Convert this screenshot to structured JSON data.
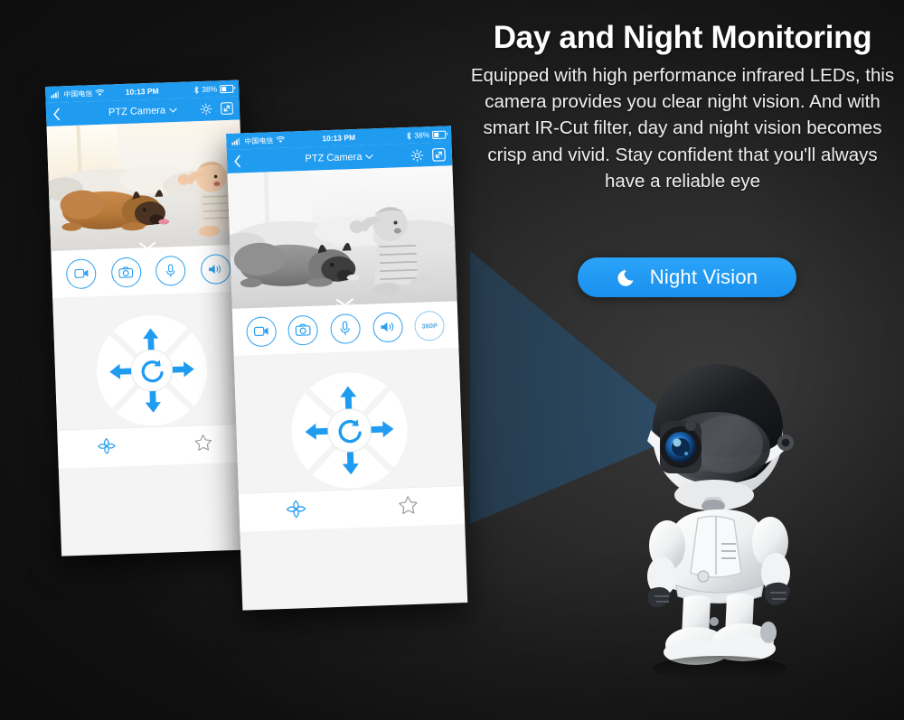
{
  "page": {
    "background_color": "#1d1d1d",
    "accent_color": "#1f9bf0"
  },
  "copy": {
    "title": "Day and Night Monitoring",
    "body": "Equipped with high performance infrared LEDs, this camera provides you clear night vision. And with smart IR-Cut filter, day and night vision becomes crisp and vivid. Stay confident that you'll always have a reliable eye",
    "button": {
      "label": "Night Vision",
      "icon": "moon-stars-icon",
      "color": "#1f9bf0"
    }
  },
  "phones": [
    {
      "id": "phone-day",
      "mode": "day",
      "status_bar": {
        "signal_icon": "signal-bars-icon",
        "carrier": "中国电信",
        "wifi_icon": "wifi-icon",
        "time": "10:13 PM",
        "bluetooth_icon": "bluetooth-icon",
        "battery_percent": "38%",
        "battery_icon": "battery-icon"
      },
      "nav_bar": {
        "back_icon": "chevron-left-icon",
        "title": "PTZ Camera",
        "dropdown_icon": "chevron-down-icon",
        "settings_icon": "gear-icon",
        "fullscreen_icon": "expand-icon"
      },
      "video": {
        "caption": "Dog and baby on floor, color daylight view",
        "grayscale": false
      },
      "expand_icon": "double-chevron-down-icon",
      "toolbar": [
        {
          "name": "record",
          "icon": "video-camera-icon",
          "label": ""
        },
        {
          "name": "snapshot",
          "icon": "photo-camera-icon",
          "label": ""
        },
        {
          "name": "microphone",
          "icon": "microphone-icon",
          "label": ""
        },
        {
          "name": "speaker",
          "icon": "speaker-icon",
          "label": ""
        }
      ],
      "dpad": {
        "up_icon": "arrow-up-icon",
        "down_icon": "arrow-down-icon",
        "left_icon": "arrow-left-icon",
        "right_icon": "arrow-right-icon",
        "center_icon": "rotate-refresh-icon"
      },
      "bottom_bar": [
        {
          "name": "ptz",
          "icon": "ptz-cross-icon"
        },
        {
          "name": "favorite",
          "icon": "star-icon"
        }
      ]
    },
    {
      "id": "phone-night",
      "mode": "night",
      "status_bar": {
        "signal_icon": "signal-bars-icon",
        "carrier": "中国电信",
        "wifi_icon": "wifi-icon",
        "time": "10:13 PM",
        "bluetooth_icon": "bluetooth-icon",
        "battery_percent": "38%",
        "battery_icon": "battery-icon"
      },
      "nav_bar": {
        "back_icon": "chevron-left-icon",
        "title": "PTZ Camera",
        "dropdown_icon": "chevron-down-icon",
        "settings_icon": "gear-icon",
        "fullscreen_icon": "expand-icon"
      },
      "video": {
        "caption": "Dog and baby on floor, black and white night vision view",
        "grayscale": true
      },
      "expand_icon": "double-chevron-down-icon",
      "toolbar": [
        {
          "name": "record",
          "icon": "video-camera-icon",
          "label": ""
        },
        {
          "name": "snapshot",
          "icon": "photo-camera-icon",
          "label": ""
        },
        {
          "name": "microphone",
          "icon": "microphone-icon",
          "label": ""
        },
        {
          "name": "speaker",
          "icon": "speaker-icon",
          "label": ""
        },
        {
          "name": "resolution",
          "icon": "resolution-badge",
          "label": "360P"
        }
      ],
      "dpad": {
        "up_icon": "arrow-up-icon",
        "down_icon": "arrow-down-icon",
        "left_icon": "arrow-left-icon",
        "right_icon": "arrow-right-icon",
        "center_icon": "rotate-refresh-icon"
      },
      "bottom_bar": [
        {
          "name": "ptz",
          "icon": "ptz-cross-icon"
        },
        {
          "name": "favorite",
          "icon": "star-icon"
        }
      ]
    }
  ],
  "product": {
    "name": "robot-camera",
    "description": "White humanoid robot security camera with blue lens"
  }
}
